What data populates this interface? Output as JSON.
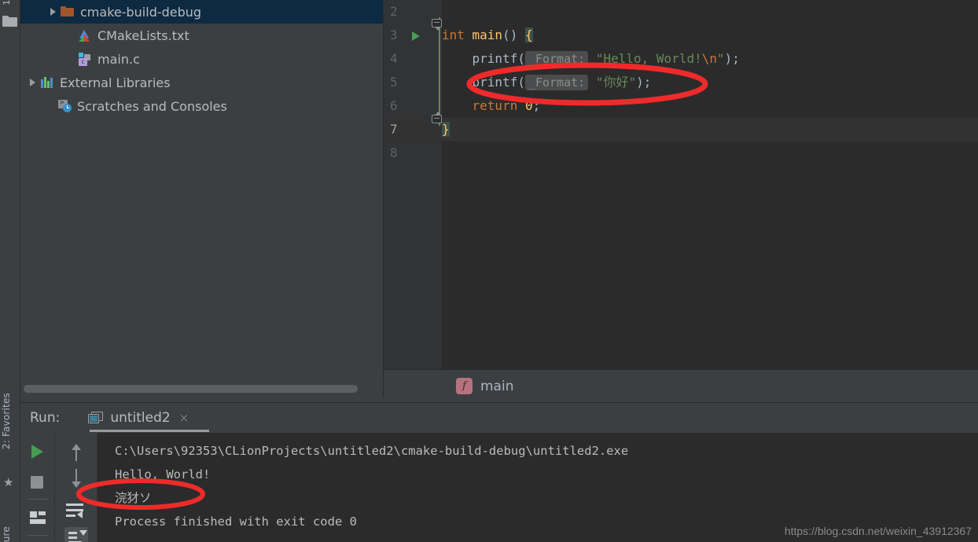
{
  "left_strip": {
    "top_tab_text": "1:",
    "folder_icon": "folder-icon",
    "favorites_label": "2: Favorites",
    "favorites_star": "★",
    "structure_label": "ure"
  },
  "project_tree": {
    "items": [
      {
        "label": "cmake-build-debug",
        "icon": "folder-icon",
        "arrow": true,
        "selected": true,
        "indent": 34
      },
      {
        "label": "CMakeLists.txt",
        "icon": "cmake-file-icon",
        "arrow": false,
        "selected": false,
        "indent": 56
      },
      {
        "label": "main.c",
        "icon": "c-file-icon",
        "arrow": false,
        "selected": false,
        "indent": 56
      },
      {
        "label": "External Libraries",
        "icon": "libraries-icon",
        "arrow": true,
        "selected": false,
        "indent": 8
      },
      {
        "label": "Scratches and Consoles",
        "icon": "scratches-icon",
        "arrow": false,
        "selected": false,
        "indent": 30
      }
    ]
  },
  "editor": {
    "line_numbers": [
      "2",
      "3",
      "4",
      "5",
      "6",
      "7",
      "8"
    ],
    "caret_line": "7",
    "run_gutter_line": "3",
    "lines": [
      {
        "num": "2",
        "tokens": []
      },
      {
        "num": "3",
        "tokens": [
          {
            "t": "int ",
            "c": "kw"
          },
          {
            "t": "main",
            "c": "fn"
          },
          {
            "t": "() ",
            "c": "plain"
          },
          {
            "t": "{",
            "c": "brace-hl"
          }
        ]
      },
      {
        "num": "4",
        "tokens": [
          {
            "t": "    printf(",
            "c": "plain"
          },
          {
            "t": "_Format:",
            "c": "hint"
          },
          {
            "t": " ",
            "c": "plain"
          },
          {
            "t": "\"Hello, World!",
            "c": "str"
          },
          {
            "t": "\\n",
            "c": "esc"
          },
          {
            "t": "\"",
            "c": "str"
          },
          {
            "t": ");",
            "c": "plain"
          }
        ]
      },
      {
        "num": "5",
        "tokens": [
          {
            "t": "    printf(",
            "c": "plain"
          },
          {
            "t": "_Format:",
            "c": "hint"
          },
          {
            "t": " ",
            "c": "plain"
          },
          {
            "t": "\"你好\"",
            "c": "str"
          },
          {
            "t": ");",
            "c": "plain"
          }
        ]
      },
      {
        "num": "6",
        "tokens": [
          {
            "t": "    ",
            "c": "plain"
          },
          {
            "t": "return ",
            "c": "kw"
          },
          {
            "t": "0",
            "c": "fn"
          },
          {
            "t": ";",
            "c": "plain"
          }
        ]
      },
      {
        "num": "7",
        "tokens": [
          {
            "t": "}",
            "c": "brace-hl"
          }
        ]
      },
      {
        "num": "8",
        "tokens": []
      }
    ]
  },
  "breadcrumb": {
    "badge": "f",
    "label": "main"
  },
  "run_window": {
    "label": "Run:",
    "tab_name": "untitled2",
    "tab_close": "×",
    "tab_icon": "console-window-icon",
    "toolbar_left": [
      "rerun-play-icon",
      "stop-icon",
      "layout-settings-icon"
    ],
    "toolbar_right": [
      "scroll-up-icon",
      "scroll-down-icon",
      "soft-wrap-icon",
      "scroll-to-end-icon"
    ],
    "console_lines": [
      "C:\\Users\\92353\\CLionProjects\\untitled2\\cmake-build-debug\\untitled2.exe",
      "Hello, World!",
      "浣犲ソ",
      "Process finished with exit code 0"
    ]
  },
  "annotations": {
    "color": "#f02a2a",
    "ellipse_code_target": "printf line 5",
    "ellipse_console_target": "garbled output line"
  },
  "watermark": {
    "text": "https://blog.csdn.net/weixin_43912367"
  },
  "colors": {
    "editor_bg": "#2b2b2b",
    "panel_bg": "#3c3f41",
    "gutter_bg": "#313335",
    "selection_blue": "#0d2a42",
    "keyword_orange": "#cc7832",
    "string_green": "#6a8759",
    "function_yellow": "#ffc66d",
    "text_gray": "#a9b7c6",
    "annotation_red": "#f02a2a"
  }
}
